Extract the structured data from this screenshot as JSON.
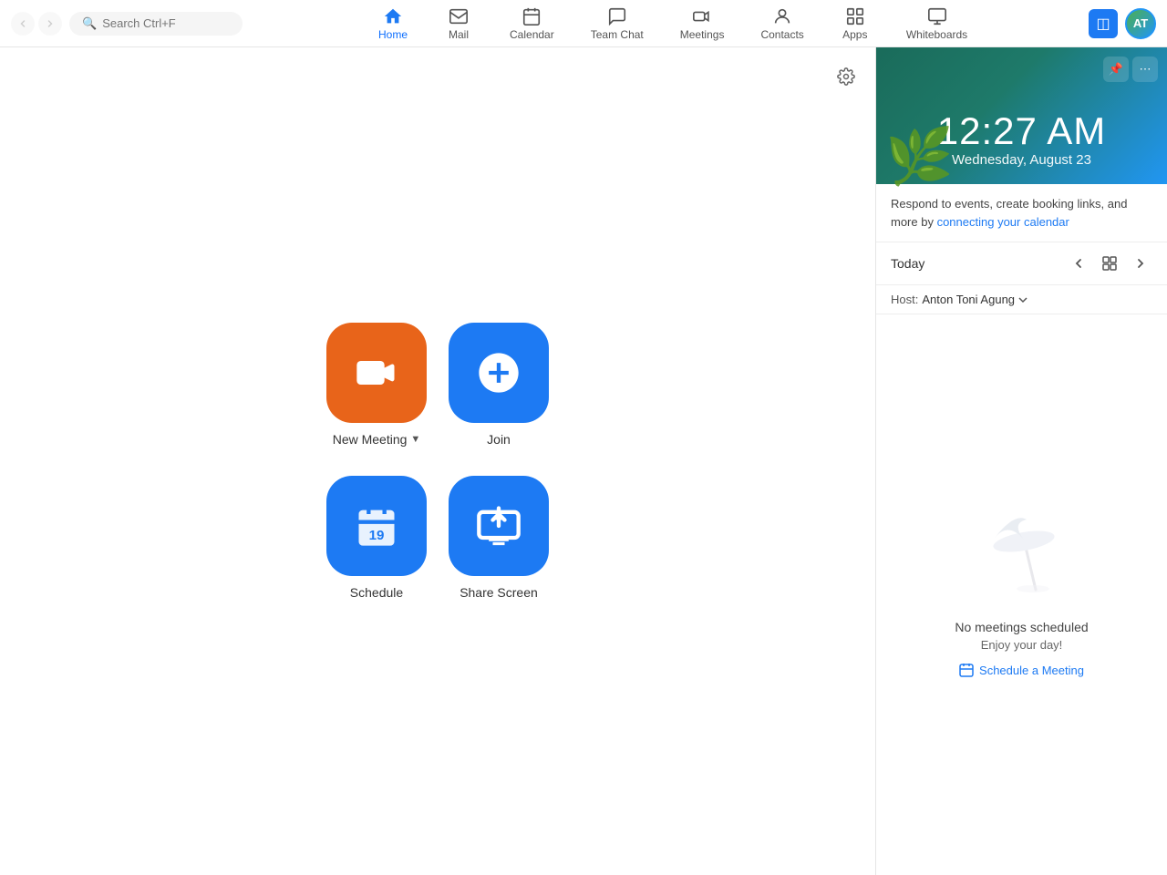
{
  "nav": {
    "search_placeholder": "Search Ctrl+F",
    "items": [
      {
        "id": "home",
        "label": "Home",
        "active": true
      },
      {
        "id": "mail",
        "label": "Mail",
        "active": false
      },
      {
        "id": "calendar",
        "label": "Calendar",
        "active": false
      },
      {
        "id": "team-chat",
        "label": "Team Chat",
        "active": false
      },
      {
        "id": "meetings",
        "label": "Meetings",
        "active": false
      },
      {
        "id": "contacts",
        "label": "Contacts",
        "active": false
      },
      {
        "id": "apps",
        "label": "Apps",
        "active": false
      },
      {
        "id": "whiteboards",
        "label": "Whiteboards",
        "active": false
      }
    ]
  },
  "actions": [
    {
      "id": "new-meeting",
      "label": "New Meeting",
      "has_chevron": true,
      "color": "orange"
    },
    {
      "id": "join",
      "label": "Join",
      "has_chevron": false,
      "color": "blue"
    },
    {
      "id": "schedule",
      "label": "Schedule",
      "has_chevron": false,
      "color": "blue"
    },
    {
      "id": "share-screen",
      "label": "Share Screen",
      "has_chevron": false,
      "color": "blue"
    }
  ],
  "sidebar": {
    "clock": {
      "time": "12:27 AM",
      "date": "Wednesday, August 23"
    },
    "calendar_info": {
      "text": "Respond to events, create booking links, and more by ",
      "link_text": "connecting your calendar"
    },
    "nav": {
      "today_label": "Today"
    },
    "host": {
      "label": "Host:",
      "name": "Anton Toni Agung"
    },
    "no_meetings": {
      "title": "No meetings scheduled",
      "subtitle": "Enjoy your day!",
      "link": "Schedule a Meeting"
    }
  }
}
